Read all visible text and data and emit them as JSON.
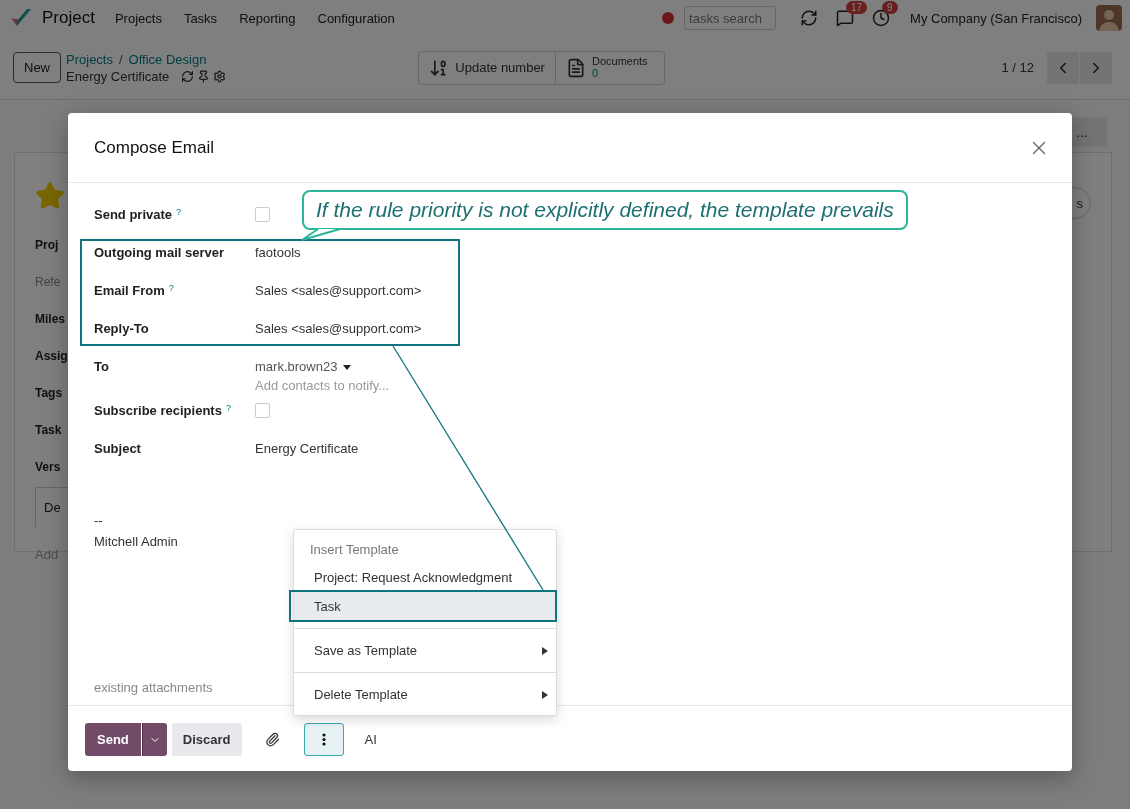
{
  "navbar": {
    "app": "Project",
    "menu": [
      "Projects",
      "Tasks",
      "Reporting",
      "Configuration"
    ],
    "search": {
      "placeholder": "tasks search"
    },
    "messages_badge": "17",
    "activities_badge": "9",
    "company": "My Company (San Francisco)"
  },
  "control_panel": {
    "new_button": "New",
    "breadcrumb": [
      "Projects",
      "Office Design"
    ],
    "separator": "/",
    "record": "Energy Certificate",
    "update_button": "Update number",
    "documents": {
      "label": "Documents",
      "count": "0"
    },
    "pager": "1 / 12"
  },
  "background_form": {
    "labels": [
      {
        "text": "Proj",
        "muted": false
      },
      {
        "text": "Refe",
        "muted": true
      },
      {
        "text": "Miles",
        "muted": false
      },
      {
        "text": "Assig",
        "muted": false
      },
      {
        "text": "Tags",
        "muted": false
      },
      {
        "text": "Task",
        "muted": false
      },
      {
        "text": "Vers",
        "muted": false
      }
    ],
    "tab": "De",
    "add_hint": "Add",
    "more_button": "...",
    "pill": "s"
  },
  "dialog": {
    "title": "Compose Email",
    "fields": [
      {
        "kind": "checkbox",
        "label": "Send private",
        "help": "?",
        "checked": false
      },
      {
        "kind": "text",
        "label": "Outgoing mail server",
        "value": "faotools"
      },
      {
        "kind": "text",
        "label": "Email From",
        "help": "?",
        "value": "Sales <sales@support.com>"
      },
      {
        "kind": "text",
        "label": "Reply-To",
        "value": "Sales <sales@support.com>"
      },
      {
        "kind": "recipients",
        "label": "To",
        "value": "mark.brown23",
        "placeholder": "Add contacts to notify..."
      },
      {
        "kind": "checkbox",
        "label": "Subscribe recipients",
        "help": "?",
        "checked": false
      },
      {
        "kind": "text",
        "label": "Subject",
        "value": "Energy Certificate"
      }
    ],
    "signature": [
      "--",
      "Mitchell Admin"
    ],
    "attachments": "existing attachments",
    "footer": {
      "send": "Send",
      "discard": "Discard",
      "ai": "AI"
    },
    "menu": {
      "header": "Insert Template",
      "items": [
        {
          "kind": "template",
          "label": "Project: Request Acknowledgment",
          "selected": false
        },
        {
          "kind": "template",
          "label": "Task",
          "selected": true
        },
        {
          "kind": "submenu",
          "label": "Save as Template",
          "selected": false
        },
        {
          "kind": "submenu",
          "label": "Delete Template",
          "selected": false
        }
      ]
    }
  },
  "annotation": {
    "callout": "If the rule priority is not explicitly defined, the template prevails"
  }
}
